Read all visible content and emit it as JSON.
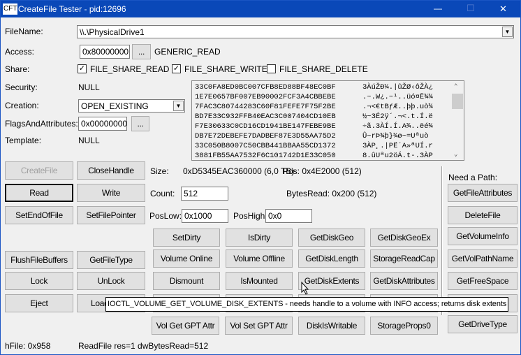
{
  "window": {
    "icon_text": "CFT",
    "title": "CreateFile Tester - pid:12696",
    "minimize": "—",
    "maximize": "☐",
    "close": "✕"
  },
  "form": {
    "filename_label": "FileName:",
    "filename_value": "\\\\.\\PhysicalDrive1",
    "access_label": "Access:",
    "access_value": "0x80000000",
    "access_browse": "...",
    "access_text": "GENERIC_READ",
    "share_label": "Share:",
    "share_options": [
      {
        "label": "FILE_SHARE_READ",
        "checked": true
      },
      {
        "label": "FILE_SHARE_WRITE",
        "checked": true
      },
      {
        "label": "FILE_SHARE_DELETE",
        "checked": false
      }
    ],
    "security_label": "Security:",
    "security_value": "NULL",
    "creation_label": "Creation:",
    "creation_value": "OPEN_EXISTING",
    "flags_label": "FlagsAndAttributes:",
    "flags_value": "0x00000000",
    "flags_browse": "...",
    "template_label": "Template:",
    "template_value": "NULL"
  },
  "hex": {
    "hex_rows": [
      "33C0FA8ED0BC007CFB8ED88BF48EC0BF",
      "1E7E0657BF007EB90002FCF3A4CBBEBE",
      "7FAC3C80744283C60F81FEFE7F75F2BE",
      "BD7E33C932FFB40EAC3C007404CD10EB",
      "F7E30633C0CD16CD1941BE147FEBE9BE",
      "DB7E72DEBEFE7DADBEF87E3D55AA75D2",
      "33C050B8007C50CBB441BBAA55CD1372",
      "3881FB55AA7532F6C101742D1E33C050"
    ],
    "ascii_rows": [
      "3ÀúŽÐ¼.|ûŽØ‹ôŽÀ¿",
      ".~.W¿.~¹..üó¤Ë¾¾",
      ".¬<€tBƒÆ..þþ.uò¾",
      "½~3É2ÿ´.¬<.t.Í.ë",
      "÷ã.3ÀÍ.Í.A¾..ëé¾",
      "Û~rÞ¾þ}­¾ø~=Uªuò",
      "3ÀP¸.|PË´A»ªUÍ.r",
      "8.ûUªu2öÁ.t-.3ÀP"
    ]
  },
  "info": {
    "size_label": "Size:",
    "size_value": "0xD5345EAC360000 (6,0 TB)",
    "pos_text": "Pos: 0x4E2000 (512)",
    "count_label": "Count:",
    "count_value": "512",
    "bytesread_text": "BytesRead: 0x200 (512)",
    "poslow_label": "PosLow:",
    "poslow_value": "0x1000",
    "poshigh_label": "PosHigh:",
    "poshigh_value": "0x0"
  },
  "buttons": {
    "createfile": "CreateFile",
    "closehandle": "CloseHandle",
    "read": "Read",
    "write": "Write",
    "setendoffile": "SetEndOfFile",
    "setfilepointer": "SetFilePointer",
    "flush": "FlushFileBuffers",
    "getfiletype": "GetFileType",
    "lock": "Lock",
    "unlock": "UnLock",
    "eject": "Eject",
    "load": "Load",
    "setdirty": "SetDirty",
    "isdirty": "IsDirty",
    "getdiskgeo": "GetDiskGeo",
    "getdiskgeoex": "GetDiskGeoEx",
    "volonline": "Volume Online",
    "voloffline": "Volume Offline",
    "getdisklength": "GetDiskLength",
    "storagereadcap": "StorageReadCap",
    "dismount": "Dismount",
    "ismounted": "IsMounted",
    "getdiskextents": "GetDiskExtents",
    "getdiskattributes": "GetDiskAttributes",
    "volgetgpt": "Vol Get GPT Attr",
    "volsetgpt": "Vol Set GPT Attr",
    "diskiswritable": "DiskIsWritable",
    "storageprops0": "StorageProps0"
  },
  "path_panel": {
    "label": "Need a Path:",
    "buttons": [
      "GetFileAttributes",
      "DeleteFile",
      "GetVolumeInfo",
      "GetVolPathName",
      "GetFreeSpace",
      "GetDriveType"
    ]
  },
  "tooltip": "IOCTL_VOLUME_GET_VOLUME_DISK_EXTENTS - needs handle to a volume with INFO access; returns disk extents",
  "status": {
    "hfile": "hFile: 0x958",
    "result": "ReadFile res=1 dwBytesRead=512"
  }
}
